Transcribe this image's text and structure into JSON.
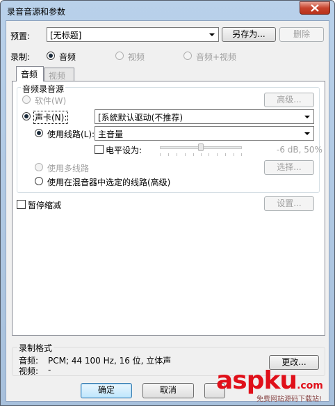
{
  "window": {
    "title": "录音音源和参数"
  },
  "preset": {
    "label": "预置:",
    "value": "[无标题]",
    "save_as_label": "另存为...",
    "delete_label": "删除"
  },
  "record": {
    "label": "录制:",
    "options": [
      "音频",
      "视频",
      "音频+视频"
    ],
    "selected": "音频"
  },
  "tabs": [
    {
      "label": "音频"
    },
    {
      "label": "视频"
    }
  ],
  "audio_source": {
    "group_title": "音频录音源",
    "software_label": "软件(W)",
    "advanced_label": "高级...",
    "soundcard_label": "声卡(N):",
    "driver_value": "[系統默认驱动(不推荐)",
    "use_line_label": "使用线路(L):",
    "line_value": "主音量",
    "level_label": "电平设为:",
    "level_readout": "-6 dB, 50%",
    "level_fraction": 0.5,
    "multi_line_label": "使用多线路",
    "select_label": "选择...",
    "mixer_line_label": "使用在混音器中选定的线路(高级)"
  },
  "pause_fade": {
    "label": "暂停缩减",
    "settings_label": "设置..."
  },
  "format": {
    "group_title": "录制格式",
    "audio_label": "音频:",
    "audio_value": "PCM; 44 100 Hz, 16 位, 立体声",
    "video_label": "视频:",
    "video_value": "-",
    "change_label": "更改..."
  },
  "footer": {
    "ok_label": "确定",
    "cancel_label": "取消"
  },
  "watermark": {
    "brand": "aspku",
    "domain": ".com",
    "tagline": "免费网站源码下载站!"
  }
}
